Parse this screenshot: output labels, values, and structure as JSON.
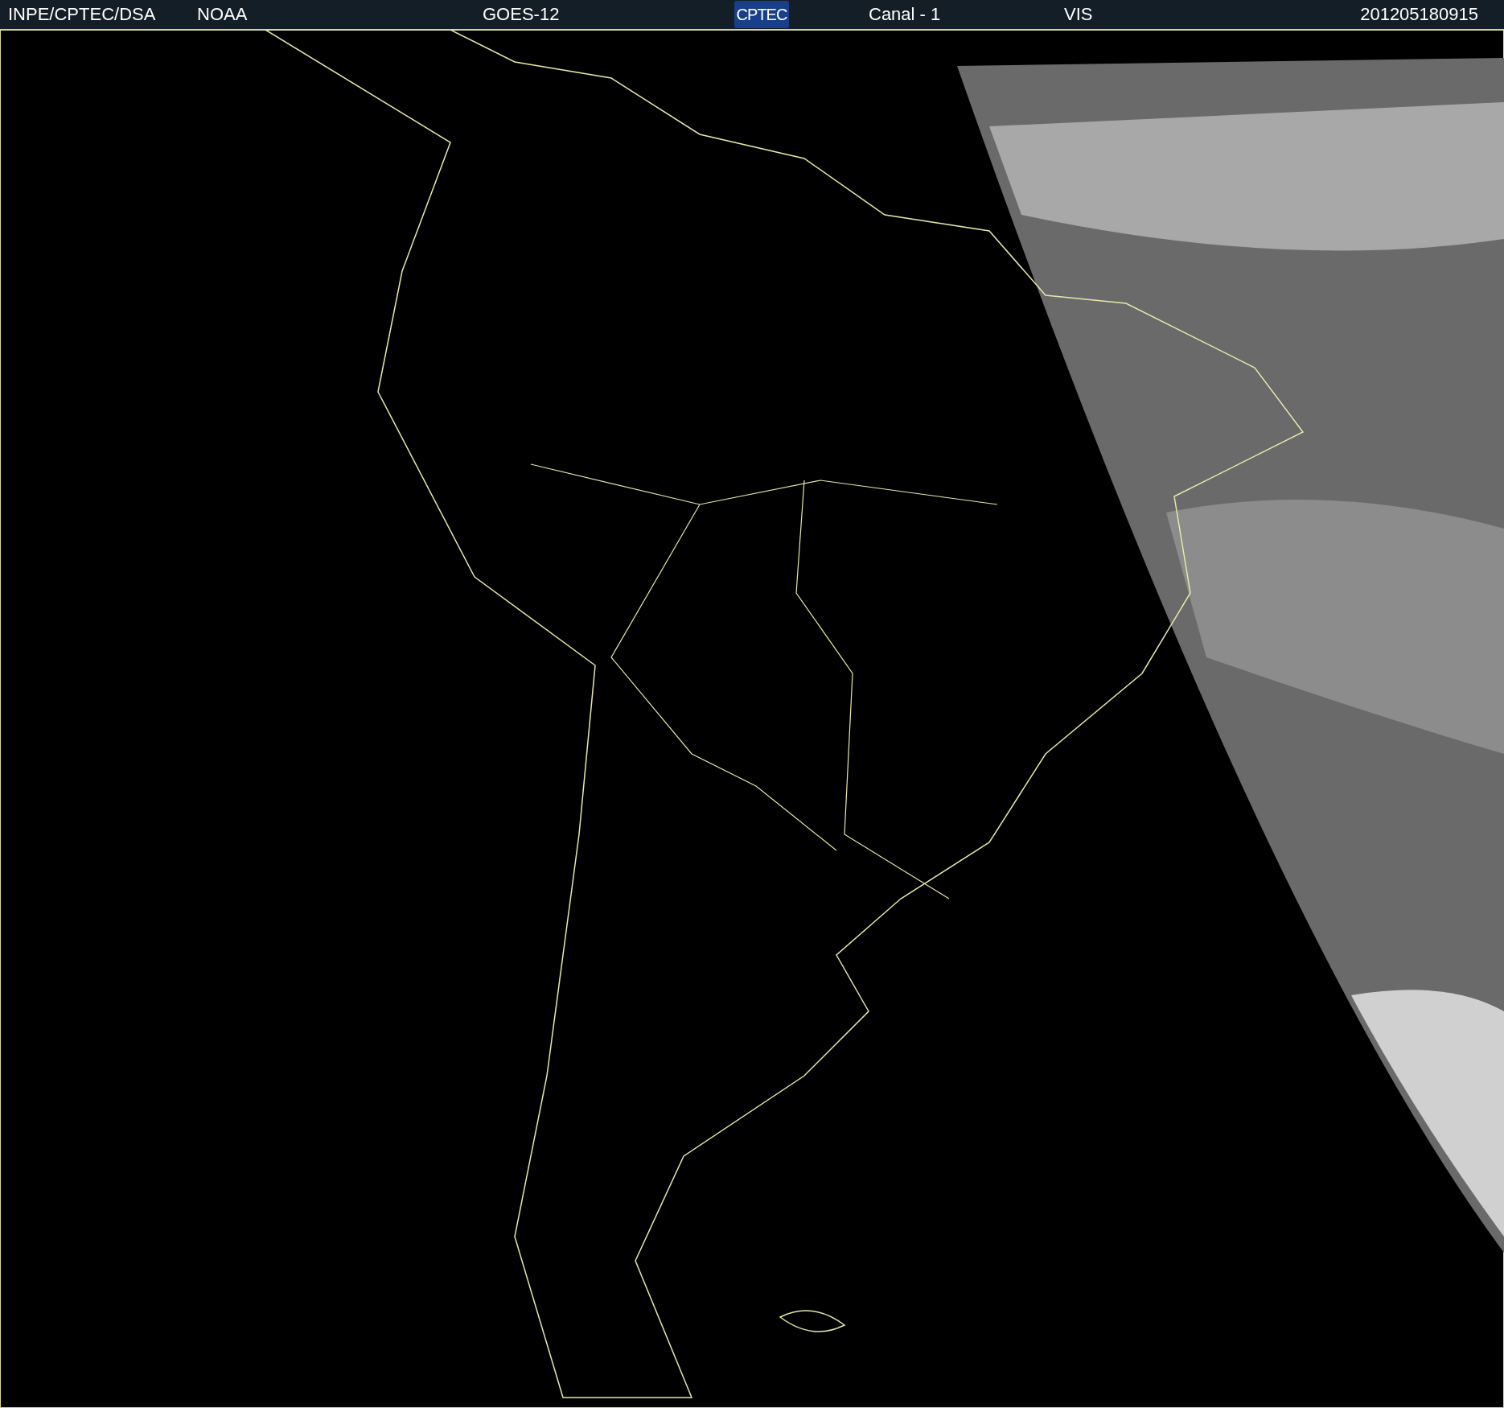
{
  "header": {
    "source": "INPE/CPTEC/DSA",
    "agency": "NOAA",
    "satellite": "GOES-12",
    "logo": "CPTEC",
    "channel": "Canal - 1",
    "band": "VIS",
    "timestamp": "201205180915"
  }
}
